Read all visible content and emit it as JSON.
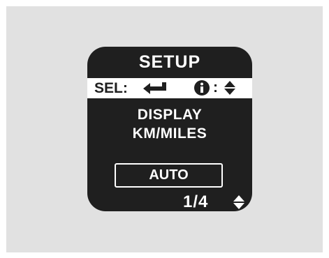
{
  "screen": {
    "title": "SETUP",
    "sel_label": "SEL:",
    "info_colon": ":",
    "line1": "DISPLAY",
    "line2": "KM/MILES",
    "value": "AUTO",
    "page_indicator": "1/4"
  },
  "icons": {
    "enter": "enter-return-arrow",
    "info": "info-circle",
    "updown": "up-down-arrows"
  },
  "colors": {
    "screen_bg": "#1f1f1f",
    "text": "#ffffff",
    "bar": "#ffffff",
    "outer_bg": "#e1e1e1"
  }
}
